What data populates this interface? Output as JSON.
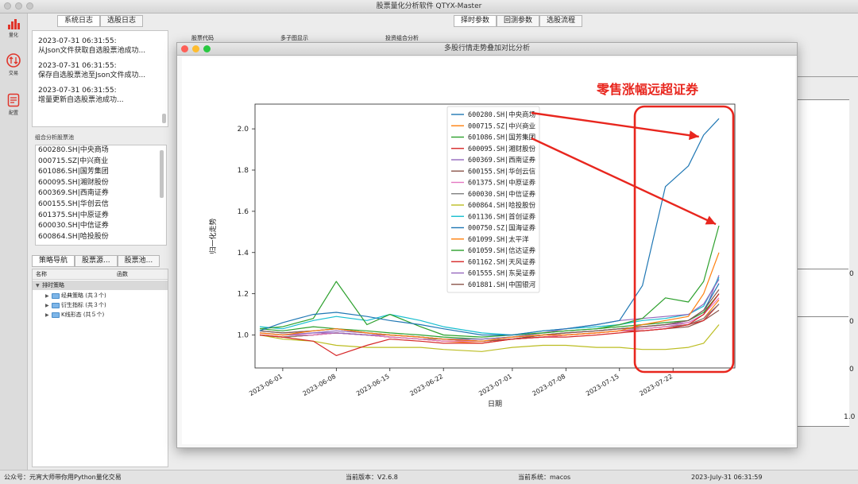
{
  "app": {
    "title": "股票量化分析软件 QTYX-Master"
  },
  "nav": [
    {
      "label": "量化",
      "icon": "bar-chart-icon"
    },
    {
      "label": "交易",
      "icon": "trade-icon"
    },
    {
      "label": "配置",
      "icon": "config-icon"
    }
  ],
  "log_tabs": [
    "系统日志",
    "选股日志"
  ],
  "logs": [
    {
      "time": "2023-07-31 06:31:55:",
      "msg": "从Json文件获取自选股票池成功..."
    },
    {
      "time": "2023-07-31 06:31:55:",
      "msg": "保存自选股票池至Json文件成功..."
    },
    {
      "time": "2023-07-31 06:31:55:",
      "msg": "增量更新自选股票池成功..."
    }
  ],
  "group_label": "组合分析股票池",
  "stock_pool": [
    "600280.SH|中央商场",
    "000715.SZ|中兴商业",
    "601086.SH|国芳集团",
    "600095.SH|湘财股份",
    "600369.SH|西南证券",
    "600155.SH|华创云信",
    "601375.SH|中原证券",
    "600030.SH|中信证券",
    "600864.SH|哈投股份"
  ],
  "strategy_tabs": [
    "策略导航",
    "股票源...",
    "股票池..."
  ],
  "strategy_columns": [
    "名称",
    "函数"
  ],
  "strategy_tree": {
    "root": "排时策略",
    "children": [
      "经典策略 (共３个)",
      "衍生指标 (共３个)",
      "K线形态 (共５个)"
    ]
  },
  "top_tabs": [
    "择时参数",
    "回测参数",
    "选股流程"
  ],
  "bg_labels": [
    "股票代码",
    "多子图显示",
    "投资组合分析"
  ],
  "bg_axis_values": [
    "0",
    "0",
    "0",
    "1.0"
  ],
  "status": {
    "left": "公众号：元宵大师带你用Python量化交易",
    "version": "当前版本：V2.6.8",
    "system": "当前系统：macos",
    "time": "2023-July-31 06:31:59"
  },
  "chart_window": {
    "title": "多股行情走势叠加对比分析"
  },
  "annotation": {
    "text": "零售涨幅远超证券",
    "color": "#e8261e"
  },
  "chart_data": {
    "type": "line",
    "title": "",
    "xlabel": "日期",
    "ylabel": "归一化走势",
    "ylim": [
      0.84,
      2.12
    ],
    "yticks": [
      1.0,
      1.2,
      1.4,
      1.6,
      1.8,
      2.0
    ],
    "xticks": [
      "2023-06-01",
      "2023-06-08",
      "2023-06-15",
      "2023-06-22",
      "2023-07-01",
      "2023-07-08",
      "2023-07-15",
      "2023-07-22"
    ],
    "x": [
      "2023-05-29",
      "2023-06-01",
      "2023-06-05",
      "2023-06-08",
      "2023-06-12",
      "2023-06-15",
      "2023-06-19",
      "2023-06-22",
      "2023-06-27",
      "2023-07-01",
      "2023-07-05",
      "2023-07-08",
      "2023-07-12",
      "2023-07-15",
      "2023-07-18",
      "2023-07-21",
      "2023-07-24",
      "2023-07-26",
      "2023-07-28"
    ],
    "grid": false,
    "legend_position": "top-center",
    "series": [
      {
        "name": "600280.SH|中央商场",
        "color": "#1f77b4",
        "values": [
          1.02,
          1.06,
          1.1,
          1.11,
          1.09,
          1.07,
          1.05,
          1.03,
          1.0,
          1.0,
          1.02,
          1.03,
          1.05,
          1.07,
          1.24,
          1.72,
          1.82,
          1.97,
          2.05
        ]
      },
      {
        "name": "000715.SZ|中兴商业",
        "color": "#ff7f0e",
        "values": [
          1.01,
          1.0,
          1.02,
          1.03,
          1.01,
          1.0,
          0.99,
          0.98,
          0.97,
          0.99,
          1.0,
          1.0,
          1.01,
          1.02,
          1.05,
          1.07,
          1.09,
          1.2,
          1.4
        ]
      },
      {
        "name": "601086.SH|国芳集团",
        "color": "#2ca02c",
        "values": [
          1.03,
          1.04,
          1.08,
          1.26,
          1.05,
          1.1,
          1.04,
          1.0,
          0.99,
          1.0,
          1.01,
          1.02,
          1.03,
          1.05,
          1.08,
          1.18,
          1.16,
          1.26,
          1.53
        ]
      },
      {
        "name": "600095.SH|湘财股份",
        "color": "#d62728",
        "values": [
          1.0,
          0.99,
          0.97,
          0.9,
          0.95,
          0.98,
          0.97,
          0.96,
          0.96,
          0.98,
          0.99,
          0.99,
          1.0,
          1.01,
          1.02,
          1.03,
          1.05,
          1.1,
          1.2
        ]
      },
      {
        "name": "600369.SH|西南证券",
        "color": "#9467bd",
        "values": [
          1.01,
          1.0,
          1.01,
          1.01,
          1.0,
          1.0,
          0.99,
          0.98,
          0.98,
          0.99,
          1.01,
          1.03,
          1.05,
          1.07,
          1.08,
          1.09,
          1.1,
          1.15,
          1.27
        ]
      },
      {
        "name": "600155.SH|华创云信",
        "color": "#8c564b",
        "values": [
          1.02,
          1.01,
          1.02,
          1.03,
          1.01,
          1.0,
          0.99,
          0.98,
          0.97,
          0.98,
          1.0,
          1.01,
          1.02,
          1.03,
          1.04,
          1.05,
          1.07,
          1.12,
          1.22
        ]
      },
      {
        "name": "601375.SH|中原证券",
        "color": "#e377c2",
        "values": [
          1.01,
          1.0,
          1.0,
          1.01,
          1.0,
          0.99,
          0.98,
          0.97,
          0.97,
          0.98,
          0.99,
          1.0,
          1.01,
          1.02,
          1.03,
          1.04,
          1.06,
          1.1,
          1.18
        ]
      },
      {
        "name": "600030.SH|中信证券",
        "color": "#7f7f7f",
        "values": [
          1.0,
          0.99,
          1.0,
          1.01,
          1.0,
          0.99,
          0.98,
          0.98,
          0.97,
          0.98,
          1.0,
          1.01,
          1.02,
          1.03,
          1.03,
          1.04,
          1.05,
          1.08,
          1.15
        ]
      },
      {
        "name": "600864.SH|哈投股份",
        "color": "#bcbd22",
        "values": [
          1.0,
          0.98,
          0.97,
          0.95,
          0.94,
          0.94,
          0.94,
          0.93,
          0.92,
          0.94,
          0.95,
          0.95,
          0.94,
          0.94,
          0.93,
          0.93,
          0.94,
          0.96,
          1.05
        ]
      },
      {
        "name": "601136.SH|首创证券",
        "color": "#17becf",
        "values": [
          1.04,
          1.03,
          1.07,
          1.09,
          1.07,
          1.1,
          1.07,
          1.04,
          1.01,
          1.0,
          1.02,
          1.03,
          1.04,
          1.05,
          1.07,
          1.08,
          1.1,
          1.14,
          1.28
        ]
      },
      {
        "name": "000750.SZ|国海证券",
        "color": "#1f77b4",
        "values": [
          1.02,
          1.01,
          1.02,
          1.03,
          1.01,
          1.0,
          0.99,
          0.98,
          0.97,
          0.98,
          1.0,
          1.01,
          1.02,
          1.03,
          1.04,
          1.05,
          1.07,
          1.12,
          1.25
        ]
      },
      {
        "name": "601099.SH|太平洋",
        "color": "#ff7f0e",
        "values": [
          1.0,
          0.99,
          1.0,
          1.01,
          1.0,
          0.99,
          0.98,
          0.97,
          0.96,
          0.98,
          0.99,
          1.0,
          1.01,
          1.02,
          1.03,
          1.04,
          1.05,
          1.08,
          1.17
        ]
      },
      {
        "name": "601059.SH|信达证券",
        "color": "#2ca02c",
        "values": [
          1.03,
          1.02,
          1.04,
          1.03,
          1.02,
          1.01,
          1.0,
          0.99,
          0.98,
          0.99,
          1.01,
          1.02,
          1.03,
          1.04,
          1.05,
          1.06,
          1.07,
          1.11,
          1.2
        ]
      },
      {
        "name": "601162.SH|天风证券",
        "color": "#d62728",
        "values": [
          1.0,
          0.99,
          1.0,
          1.01,
          1.0,
          0.99,
          0.98,
          0.97,
          0.97,
          0.98,
          0.99,
          1.0,
          1.01,
          1.02,
          1.02,
          1.03,
          1.05,
          1.07,
          1.15
        ]
      },
      {
        "name": "601555.SH|东吴证券",
        "color": "#9467bd",
        "values": [
          1.01,
          1.0,
          1.01,
          1.02,
          1.01,
          1.0,
          0.99,
          0.98,
          0.98,
          0.99,
          1.0,
          1.01,
          1.02,
          1.03,
          1.04,
          1.05,
          1.06,
          1.1,
          1.29
        ]
      },
      {
        "name": "601881.SH|中国银河",
        "color": "#8c564b",
        "values": [
          1.0,
          0.99,
          1.0,
          1.01,
          1.0,
          0.99,
          0.98,
          0.97,
          0.97,
          0.98,
          0.99,
          1.0,
          1.01,
          1.02,
          1.02,
          1.03,
          1.04,
          1.07,
          1.12
        ]
      }
    ]
  }
}
